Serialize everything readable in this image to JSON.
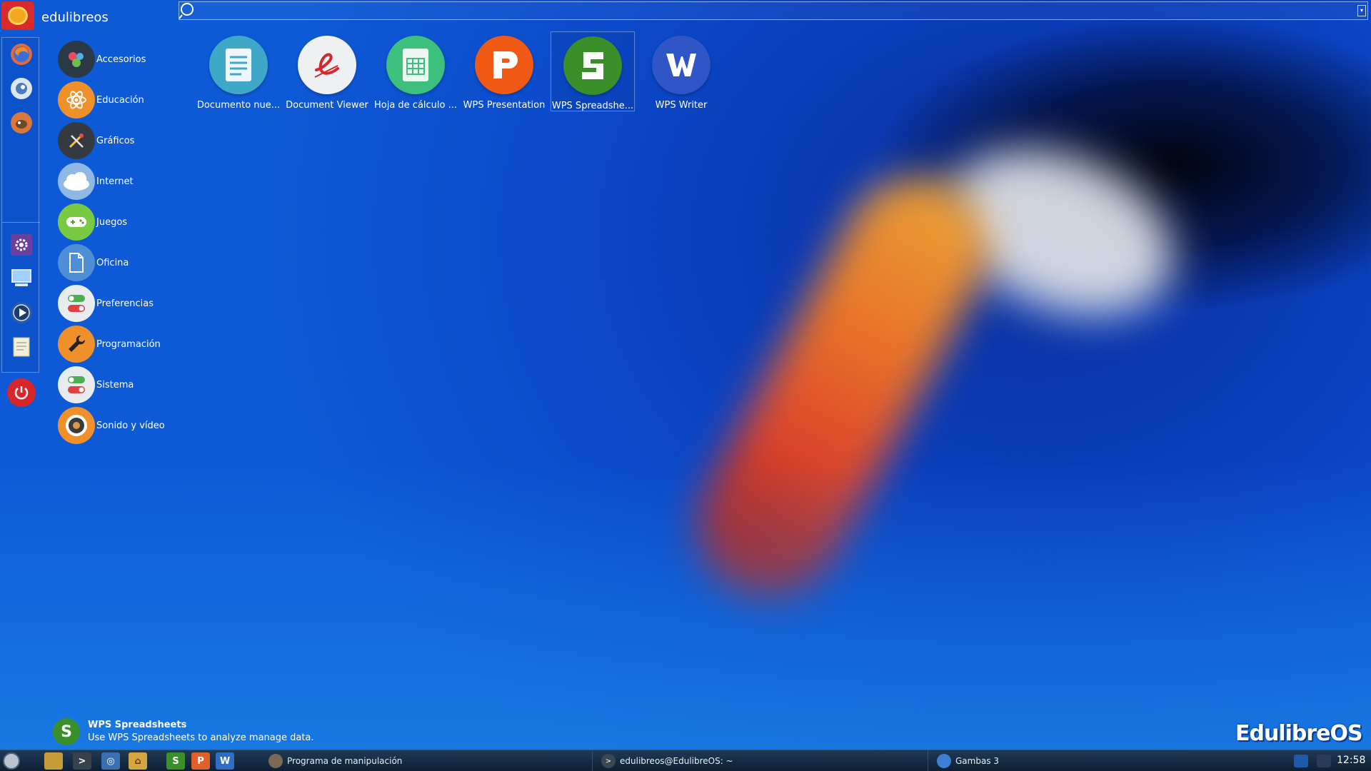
{
  "header": {
    "username": "edulibreos"
  },
  "search": {
    "placeholder": "",
    "value": ""
  },
  "favorites": [
    {
      "icon": "firefox-icon",
      "color": "#e8673a"
    },
    {
      "icon": "thunderbird-icon",
      "color": "#dce6ef"
    },
    {
      "icon": "gimp-icon",
      "color": "#d9783a"
    },
    {
      "icon": "settings-icon",
      "color": "#6a3f9e"
    },
    {
      "icon": "monitor-icon",
      "color": "#3c7bd0"
    },
    {
      "icon": "media-player-icon",
      "color": "#2b5aa6"
    },
    {
      "icon": "text-editor-icon",
      "color": "#e9e4c8"
    },
    {
      "icon": "power-icon",
      "color": "#d8262b"
    }
  ],
  "categories": [
    {
      "label": "Accesorios",
      "icon": "accessories-icon",
      "color": "#2b3947"
    },
    {
      "label": "Educación",
      "icon": "education-icon",
      "color": "#f0902a"
    },
    {
      "label": "Gráficos",
      "icon": "graphics-icon",
      "color": "#343a40"
    },
    {
      "label": "Internet",
      "icon": "internet-cloud-icon",
      "color": "#8fb8e6"
    },
    {
      "label": "Juegos",
      "icon": "games-icon",
      "color": "#7ac943"
    },
    {
      "label": "Oficina",
      "icon": "office-icon",
      "color": "#4f8fd6"
    },
    {
      "label": "Preferencias",
      "icon": "preferences-icon",
      "color": "#e9ecef"
    },
    {
      "label": "Programación",
      "icon": "programming-icon",
      "color": "#f0902a"
    },
    {
      "label": "Sistema",
      "icon": "system-icon",
      "color": "#e9ecef"
    },
    {
      "label": "Sonido y vídeo",
      "icon": "sound-video-icon",
      "color": "#f0902a"
    }
  ],
  "apps": [
    {
      "label": "Documento nue...",
      "icon": "document-icon",
      "color": "#3fa7c8",
      "glyph": "☰"
    },
    {
      "label": "Document Viewer",
      "icon": "document-viewer-icon",
      "color": "#eef0f2",
      "glyph": "e"
    },
    {
      "label": "Hoja de cálculo ...",
      "icon": "spreadsheet-icon",
      "color": "#3dbf7e",
      "glyph": "▦"
    },
    {
      "label": "WPS Presentation",
      "icon": "wps-presentation-icon",
      "color": "#f05a14",
      "glyph": "P"
    },
    {
      "label": "WPS Spreadshe...",
      "icon": "wps-spreadsheets-icon",
      "color": "#3b8f2b",
      "glyph": "S"
    },
    {
      "label": "WPS Writer",
      "icon": "wps-writer-icon",
      "color": "#2f55c6",
      "glyph": "W"
    }
  ],
  "description": {
    "title": "WPS Spreadsheets",
    "text": "Use WPS Spreadsheets to analyze manage data.",
    "glyph": "S"
  },
  "brand": "EdulibreOS",
  "taskbar": {
    "tasks": [
      {
        "label": "Programa de manipulación",
        "icon": "gimp-icon"
      },
      {
        "label": "edulibreos@EdulibreOS: ~",
        "icon": "terminal-icon"
      },
      {
        "label": "Gambas 3",
        "icon": "gambas-icon"
      }
    ],
    "launchers": [
      {
        "icon": "file-manager-icon",
        "color": "#c79a3a",
        "glyph": ""
      },
      {
        "icon": "terminal-icon",
        "color": "#38424c",
        "glyph": ">"
      },
      {
        "icon": "web-browser-icon",
        "color": "#3a6fb0",
        "glyph": "◎"
      },
      {
        "icon": "home-folder-icon",
        "color": "#d5a640",
        "glyph": "⌂"
      },
      {
        "icon": "wps-spreadsheets-icon",
        "color": "#3b8f2b",
        "glyph": "S"
      },
      {
        "icon": "wps-presentation-icon",
        "color": "#e0602b",
        "glyph": "P"
      },
      {
        "icon": "wps-writer-icon",
        "color": "#2f6ec6",
        "glyph": "W"
      }
    ],
    "clock": "12:58"
  }
}
